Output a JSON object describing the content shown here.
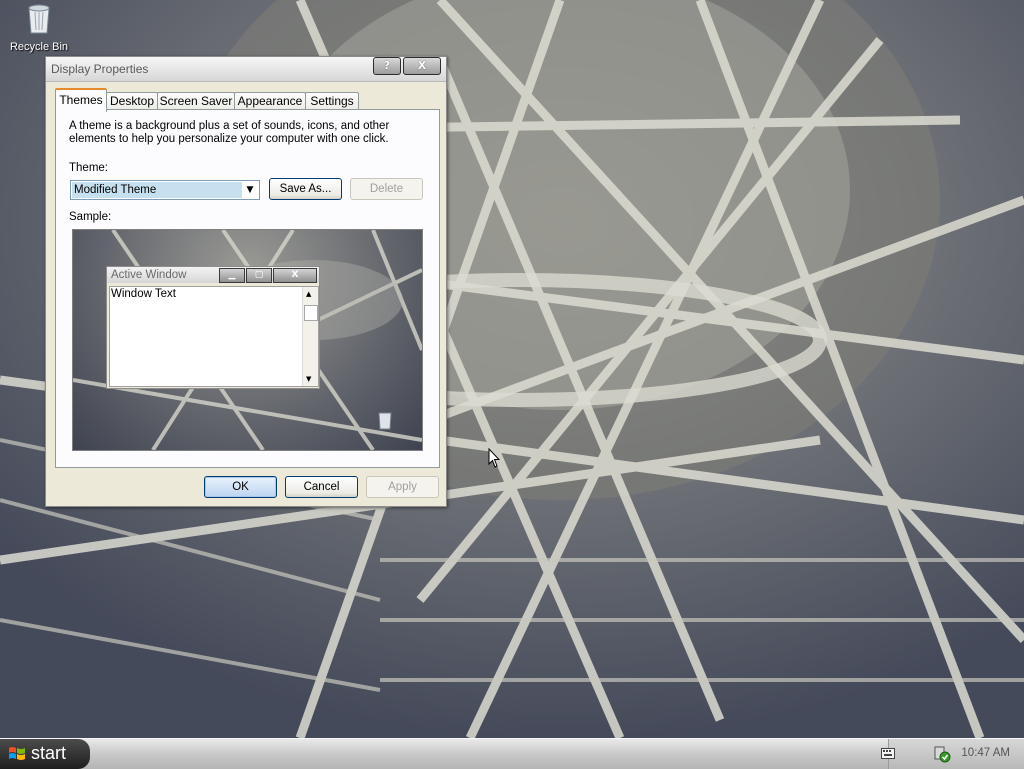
{
  "desktop": {
    "icons": [
      {
        "label": "Recycle Bin",
        "icon": "recycle-bin-icon"
      }
    ]
  },
  "dialog": {
    "title": "Display Properties",
    "help_button": "?",
    "close_button": "X",
    "tabs": [
      {
        "label": "Themes",
        "active": true
      },
      {
        "label": "Desktop",
        "active": false
      },
      {
        "label": "Screen Saver",
        "active": false
      },
      {
        "label": "Appearance",
        "active": false
      },
      {
        "label": "Settings",
        "active": false
      }
    ],
    "description": "A theme is a background plus a set of sounds, icons, and other elements to help you personalize your computer with one click.",
    "theme_label": "Theme:",
    "theme_value": "Modified Theme",
    "save_as_label": "Save As...",
    "delete_label": "Delete",
    "sample_label": "Sample:",
    "sample": {
      "window_title": "Active Window",
      "window_text": "Window Text"
    },
    "ok_label": "OK",
    "cancel_label": "Cancel",
    "apply_label": "Apply"
  },
  "taskbar": {
    "start_label": "start",
    "clock": "10:47 AM"
  },
  "colors": {
    "dialog_face": "#ece9d8",
    "tab_highlight": "#e68b2c",
    "selection": "#c7e0f0"
  }
}
